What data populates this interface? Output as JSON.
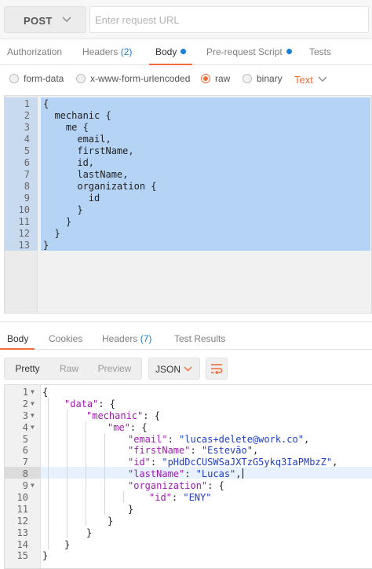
{
  "request": {
    "method": "POST",
    "url_placeholder": "Enter request URL"
  },
  "request_tabs": [
    {
      "label": "Authorization"
    },
    {
      "label": "Headers",
      "count": "(2)"
    },
    {
      "label": "Body",
      "active": true
    },
    {
      "label": "Pre-request Script"
    },
    {
      "label": "Tests"
    }
  ],
  "body_modes": [
    {
      "label": "form-data",
      "checked": false
    },
    {
      "label": "x-www-form-urlencoded",
      "checked": false
    },
    {
      "label": "raw",
      "checked": true
    },
    {
      "label": "binary",
      "checked": false
    }
  ],
  "raw_type": "Text",
  "request_body_lines": [
    {
      "n": "1",
      "text": "{"
    },
    {
      "n": "2",
      "text": "  mechanic {"
    },
    {
      "n": "3",
      "text": "    me {"
    },
    {
      "n": "4",
      "text": "      email,"
    },
    {
      "n": "5",
      "text": "      firstName,"
    },
    {
      "n": "6",
      "text": "      id,"
    },
    {
      "n": "7",
      "text": "      lastName,"
    },
    {
      "n": "8",
      "text": "      organization {"
    },
    {
      "n": "9",
      "text": "        id"
    },
    {
      "n": "10",
      "text": "      }"
    },
    {
      "n": "11",
      "text": "    }"
    },
    {
      "n": "12",
      "text": "  }"
    },
    {
      "n": "13",
      "text": "}"
    }
  ],
  "response_tabs": [
    {
      "label": "Body",
      "active": true
    },
    {
      "label": "Cookies"
    },
    {
      "label": "Headers",
      "count": "(7)"
    },
    {
      "label": "Test Results"
    }
  ],
  "view_modes": [
    "Pretty",
    "Raw",
    "Preview"
  ],
  "active_view": "Pretty",
  "format": "JSON",
  "response_lines": [
    {
      "n": "1",
      "fold": true
    },
    {
      "n": "2",
      "fold": true
    },
    {
      "n": "3",
      "fold": true
    },
    {
      "n": "4",
      "fold": true
    },
    {
      "n": "5",
      "key": "\"email\"",
      "value": "\"lucas+delete@work.co\"",
      "tail": ","
    },
    {
      "n": "6",
      "key": "\"firstName\"",
      "value": "\"Estevão\"",
      "tail": ","
    },
    {
      "n": "7",
      "key": "\"id\"",
      "value": "\"pHdDcCUSWSaJXTzG5ykq3IaPMbzZ\"",
      "tail": ","
    },
    {
      "n": "8",
      "key": "\"lastName\"",
      "value": "\"Lucas\"",
      "tail": ","
    },
    {
      "n": "9",
      "fold": true,
      "key": "\"organization\"",
      "tail": ": {"
    },
    {
      "n": "10",
      "key": "\"id\"",
      "value": "\"ENY\""
    },
    {
      "n": "11",
      "text": "}"
    },
    {
      "n": "12",
      "text": "}"
    },
    {
      "n": "13",
      "text": "}"
    },
    {
      "n": "14",
      "text": "}"
    },
    {
      "n": "15",
      "text": "}"
    }
  ],
  "response_json": {
    "l1": "{",
    "l2_key": "\"data\"",
    "l2_tail": ": {",
    "l3_key": "\"mechanic\"",
    "l3_tail": ": {",
    "l4_key": "\"me\"",
    "l4_tail": ": {",
    "colon": ": "
  },
  "icons": {
    "method_chevron": "chevron-down-icon",
    "type_chevron": "chevron-down-icon",
    "format_chevron": "chevron-down-icon",
    "wrap": "wrap-lines-icon"
  },
  "colors": {
    "accent": "#f26b3a",
    "link": "#1b7fd4",
    "selection": "#b5d3f5",
    "json_key": "#a11ab1",
    "json_string": "#1f3ec2"
  }
}
